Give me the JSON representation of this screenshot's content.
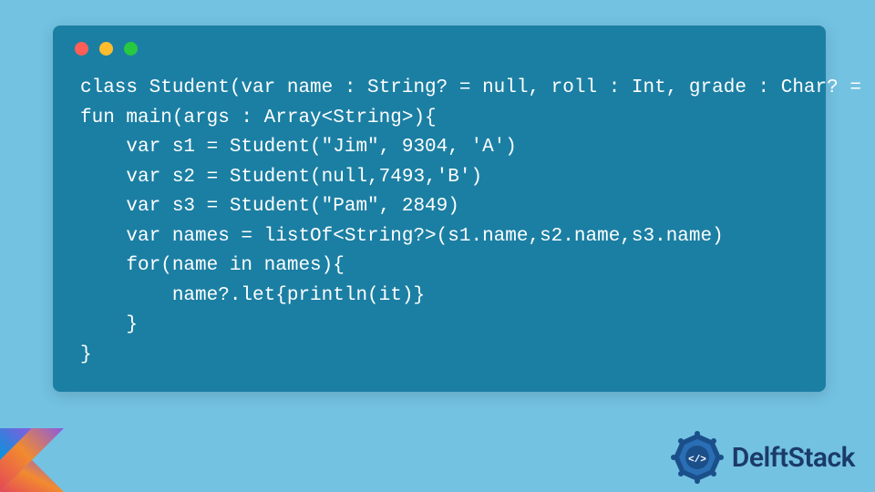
{
  "code": {
    "line1": "class Student(var name : String? = null, roll : Int, grade : Char? = 'C')",
    "line2": "fun main(args : Array<String>){",
    "line3": "    var s1 = Student(\"Jim\", 9304, 'A')",
    "line4": "    var s2 = Student(null,7493,'B')",
    "line5": "    var s3 = Student(\"Pam\", 2849)",
    "line6": "    var names = listOf<String?>(s1.name,s2.name,s3.name)",
    "line7": "    for(name in names){",
    "line8": "        name?.let{println(it)}",
    "line9": "    }",
    "line10": "}"
  },
  "brand": {
    "name": "DelftStack"
  }
}
